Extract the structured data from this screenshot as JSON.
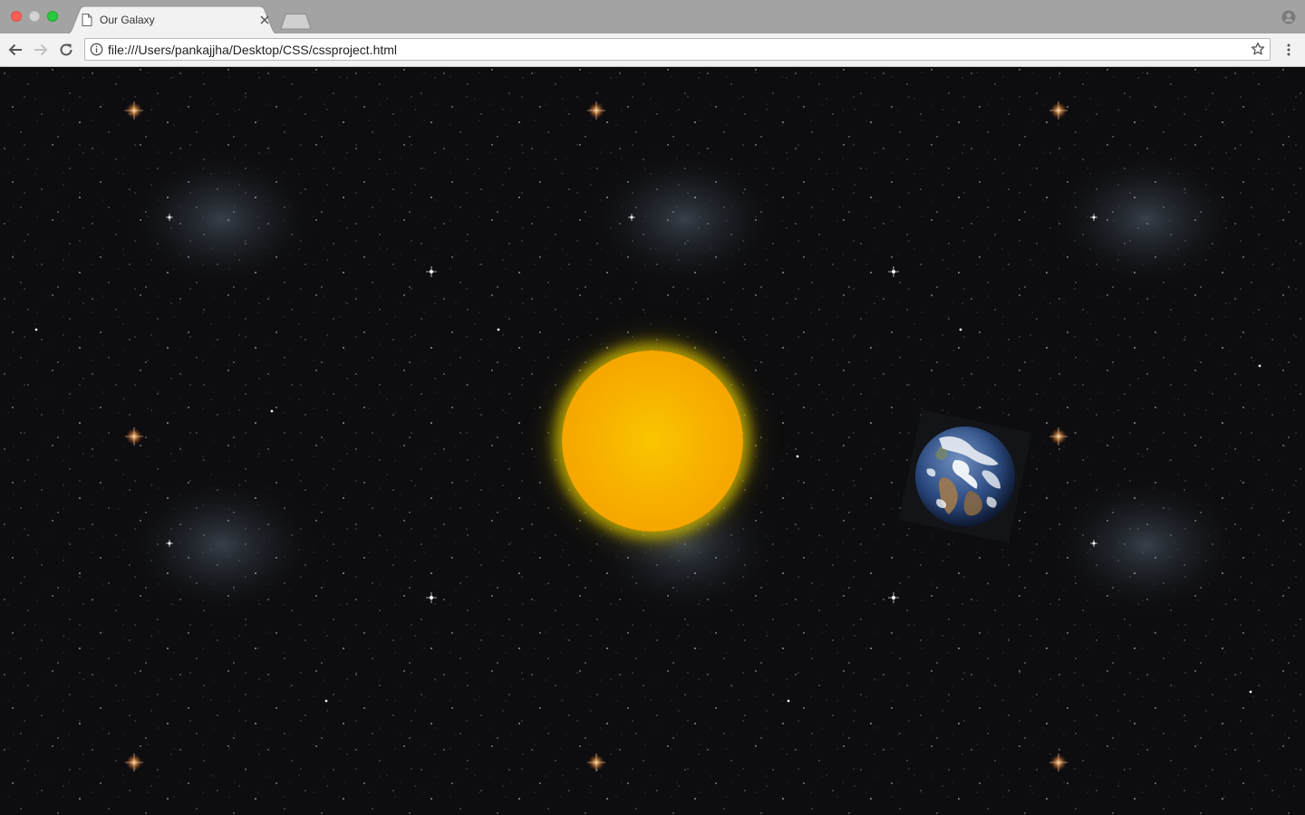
{
  "browser": {
    "tab": {
      "title": "Our Galaxy",
      "page_icon": "page-icon",
      "close_icon": "close-icon"
    },
    "new_tab_icon": "new-tab-icon",
    "profile_icon": "profile-icon",
    "toolbar": {
      "back_icon": "back-arrow-icon",
      "forward_icon": "forward-arrow-icon",
      "reload_icon": "reload-icon",
      "info_icon": "info-icon",
      "url": "file:///Users/pankajjha/Desktop/CSS/cssproject.html",
      "bookmark_icon": "star-icon",
      "menu_icon": "menu-dots-icon"
    }
  },
  "page": {
    "scene": "galaxy",
    "background": "starfield",
    "objects": [
      {
        "name": "sun",
        "color": "#f7a800",
        "glow_color": "#d4c000"
      },
      {
        "name": "earth",
        "image": "earth-globe"
      }
    ]
  },
  "colors": {
    "tabstrip": "#a3a3a3",
    "toolbar": "#f2f2f2",
    "space": "#0d0d0f",
    "sun_core": "#f9c600",
    "sun_edge": "#f59c00"
  }
}
